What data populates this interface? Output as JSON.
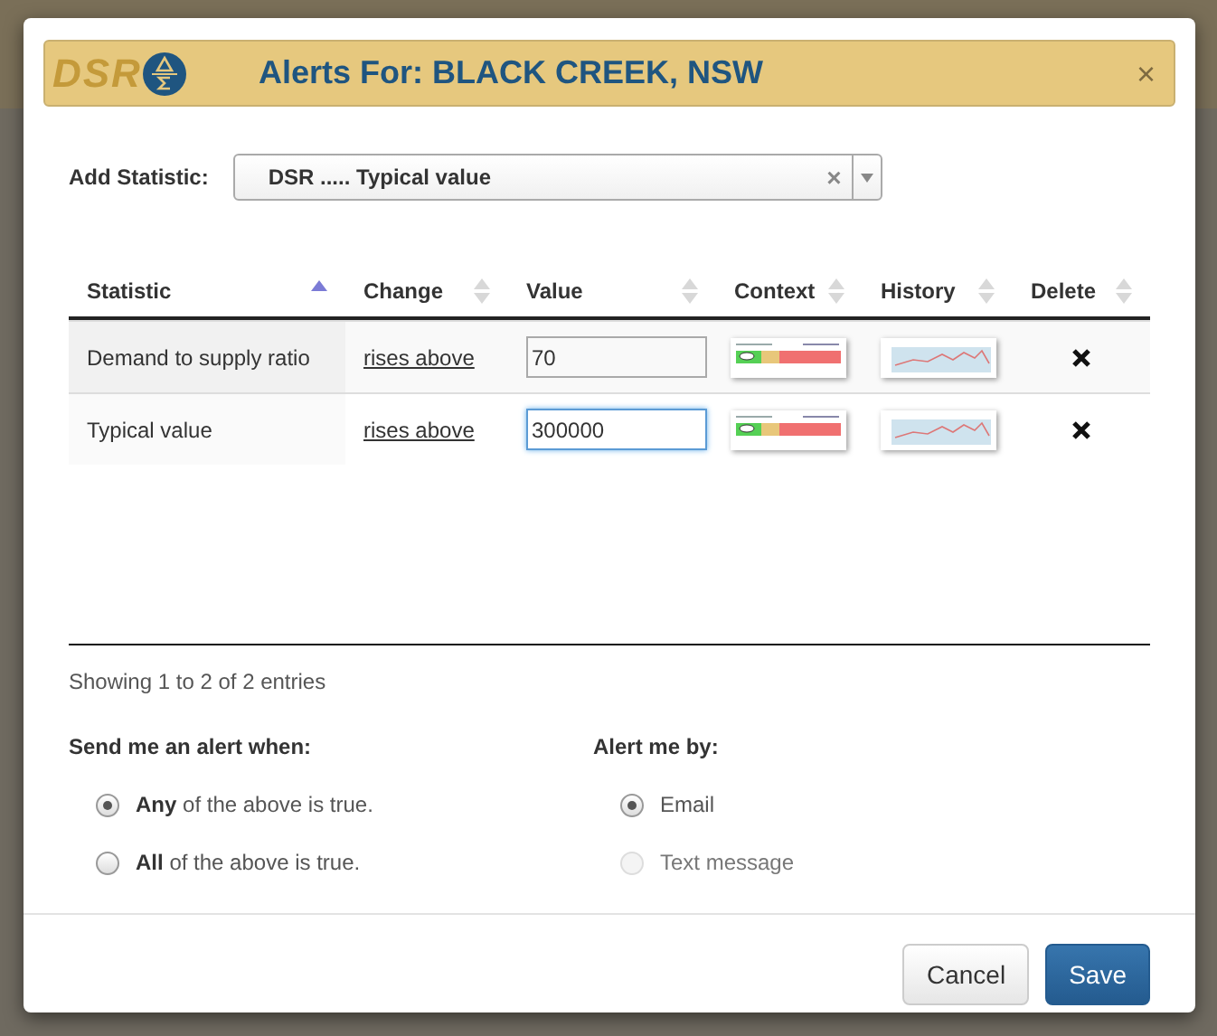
{
  "modal": {
    "title": "Alerts For: BLACK CREEK, NSW",
    "logo_text": "DSR",
    "close": "×"
  },
  "add_statistic": {
    "label": "Add Statistic:",
    "value": "DSR ..... Typical value",
    "clear": "×"
  },
  "table": {
    "columns": [
      {
        "label": "Statistic",
        "sorted": true
      },
      {
        "label": "Change",
        "sorted": false
      },
      {
        "label": "Value",
        "sorted": false
      },
      {
        "label": "Context",
        "sorted": false
      },
      {
        "label": "History",
        "sorted": false
      },
      {
        "label": "Delete",
        "sorted": false
      }
    ],
    "rows": [
      {
        "statistic": "Demand to supply ratio",
        "change": "rises above",
        "value": "70",
        "focused": false
      },
      {
        "statistic": "Typical value",
        "change": "rises above",
        "value": "300000",
        "focused": true
      }
    ]
  },
  "info": "Showing 1 to 2 of 2 entries",
  "alert_when": {
    "label": "Send me an alert when:",
    "options": [
      {
        "bold": "Any",
        "text": "of the above is true.",
        "selected": true
      },
      {
        "bold": "All",
        "text": "of the above is true.",
        "selected": false
      }
    ]
  },
  "alert_by": {
    "label": "Alert me by:",
    "options": [
      {
        "text": "Email",
        "selected": true,
        "disabled": false
      },
      {
        "text": "Text message",
        "selected": false,
        "disabled": true
      }
    ]
  },
  "buttons": [
    {
      "label": "Cancel",
      "kind": "secondary"
    },
    {
      "label": "Save",
      "kind": "primary"
    }
  ]
}
